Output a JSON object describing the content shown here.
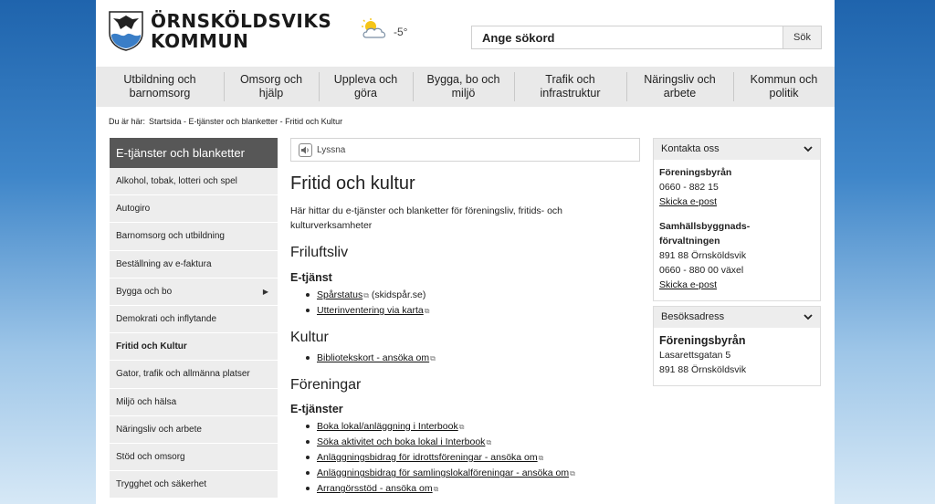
{
  "header": {
    "logo_line1": "ÖRNSKÖLDSVIKS",
    "logo_line2": "KOMMUN",
    "weather_icon": "partly-cloudy-icon",
    "temperature": "-5°",
    "search_placeholder": "Ange sökord",
    "search_button": "Sök"
  },
  "nav": [
    {
      "l1": "Utbildning och",
      "l2": "barnomsorg"
    },
    {
      "l1": "Omsorg och",
      "l2": "hjälp"
    },
    {
      "l1": "Uppleva och",
      "l2": "göra"
    },
    {
      "l1": "Bygga, bo och",
      "l2": "miljö"
    },
    {
      "l1": "Trafik och",
      "l2": "infrastruktur"
    },
    {
      "l1": "Näringsliv och",
      "l2": "arbete"
    },
    {
      "l1": "Kommun och",
      "l2": "politik"
    }
  ],
  "breadcrumb": {
    "prefix": "Du är här:",
    "path": "Startsida - E-tjänster och blanketter - Fritid och Kultur"
  },
  "sidebar": {
    "title": "E-tjänster och blanketter",
    "items": [
      "Alkohol, tobak, lotteri och spel",
      "Autogiro",
      "Barnomsorg och utbildning",
      "Beställning av e-faktura",
      "Bygga och bo",
      "Demokrati och inflytande",
      "Fritid och Kultur",
      "Gator, trafik och allmänna platser",
      "Miljö och hälsa",
      "Näringsliv och arbete",
      "Stöd och omsorg",
      "Trygghet och säkerhet"
    ]
  },
  "main": {
    "listen": "Lyssna",
    "title": "Fritid och kultur",
    "intro": "Här hittar du e-tjänster och blanketter för föreningsliv, fritids- och kulturverksamheter",
    "s1_title": "Friluftsliv",
    "s1_sub": "E-tjänst",
    "s1_links": [
      "Spårstatus",
      "Utterinventering via karta"
    ],
    "s1_note": "(skidspår.se)",
    "s2_title": "Kultur",
    "s2_links": [
      "Bibliotekskort - ansöka om"
    ],
    "s3_title": "Föreningar",
    "s3_sub": "E-tjänster",
    "s3_links": [
      "Boka lokal/anläggning i Interbook",
      "Söka aktivitet och boka lokal i Interbook",
      "Anläggningsbidrag för idrottsföreningar - ansöka om",
      "Anläggningsbidrag för samlingslokalföreningar - ansöka om",
      "Arrangörsstöd - ansöka om"
    ]
  },
  "contact": {
    "title": "Kontakta oss",
    "org1": "Föreningsbyrån",
    "phone1": "0660 - 882 15",
    "email1": "Skicka e-post",
    "org2_l1": "Samhällsbyggnads-",
    "org2_l2": "förvaltningen",
    "addr2": "891 88 Örnsköldsvik",
    "phone2": "0660 - 880 00 växel",
    "email2": "Skicka e-post"
  },
  "visit": {
    "title": "Besöksadress",
    "org": "Föreningsbyrån",
    "street": "Lasarettsgatan 5",
    "city": "891 88 Örnsköldsvik"
  },
  "colors": {
    "sidebar_head": "#575757",
    "nav_bg": "#e9e9e9",
    "sidebar_item_bg": "#ededed"
  }
}
